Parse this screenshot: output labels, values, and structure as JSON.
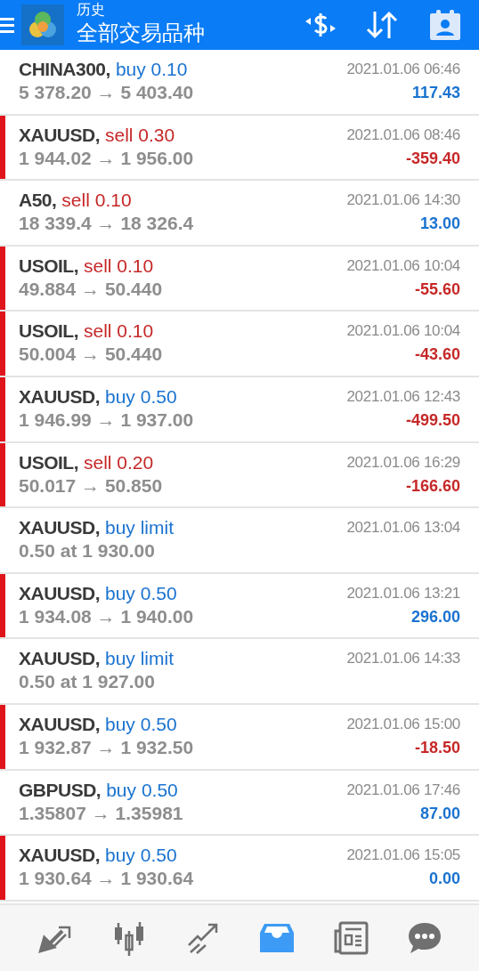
{
  "header": {
    "title": "历史",
    "subtitle": "全部交易品种"
  },
  "rows": [
    {
      "symbol": "CHINA300,",
      "kind": "buy",
      "action": "buy 0.10",
      "prices": "5 378.20 → 5 403.40",
      "time": "2021.01.06 06:46",
      "profit": {
        "text": "117.43",
        "color": "#1a73d0"
      },
      "flagged": false
    },
    {
      "symbol": "XAUUSD,",
      "kind": "sell",
      "action": "sell 0.30",
      "prices": "1 944.02 → 1 956.00",
      "time": "2021.01.06 08:46",
      "profit": {
        "text": "-359.40",
        "color": "#c62828"
      },
      "flagged": true
    },
    {
      "symbol": "A50,",
      "kind": "sell",
      "action": "sell 0.10",
      "prices": "18 339.4 → 18 326.4",
      "time": "2021.01.06 14:30",
      "profit": {
        "text": "13.00",
        "color": "#1a73d0"
      },
      "flagged": false
    },
    {
      "symbol": "USOIL,",
      "kind": "sell",
      "action": "sell 0.10",
      "prices": "49.884 → 50.440",
      "time": "2021.01.06 10:04",
      "profit": {
        "text": "-55.60",
        "color": "#c62828"
      },
      "flagged": true
    },
    {
      "symbol": "USOIL,",
      "kind": "sell",
      "action": "sell 0.10",
      "prices": "50.004 → 50.440",
      "time": "2021.01.06 10:04",
      "profit": {
        "text": "-43.60",
        "color": "#c62828"
      },
      "flagged": true
    },
    {
      "symbol": "XAUUSD,",
      "kind": "buy",
      "action": "buy 0.50",
      "prices": "1 946.99 → 1 937.00",
      "time": "2021.01.06 12:43",
      "profit": {
        "text": "-499.50",
        "color": "#c62828"
      },
      "flagged": true
    },
    {
      "symbol": "USOIL,",
      "kind": "sell",
      "action": "sell 0.20",
      "prices": "50.017 → 50.850",
      "time": "2021.01.06 16:29",
      "profit": {
        "text": "-166.60",
        "color": "#c62828"
      },
      "flagged": true
    },
    {
      "symbol": "XAUUSD,",
      "kind": "buy",
      "action": "buy limit",
      "prices": "0.50 at 1 930.00",
      "time": "2021.01.06 13:04",
      "flagged": false
    },
    {
      "symbol": "XAUUSD,",
      "kind": "buy",
      "action": "buy 0.50",
      "prices": "1 934.08 → 1 940.00",
      "time": "2021.01.06 13:21",
      "profit": {
        "text": "296.00",
        "color": "#1a73d0"
      },
      "flagged": true
    },
    {
      "symbol": "XAUUSD,",
      "kind": "buy",
      "action": "buy limit",
      "prices": "0.50 at 1 927.00",
      "time": "2021.01.06 14:33",
      "flagged": false
    },
    {
      "symbol": "XAUUSD,",
      "kind": "buy",
      "action": "buy 0.50",
      "prices": "1 932.87 → 1 932.50",
      "time": "2021.01.06 15:00",
      "profit": {
        "text": "-18.50",
        "color": "#c62828"
      },
      "flagged": true
    },
    {
      "symbol": "GBPUSD,",
      "kind": "buy",
      "action": "buy 0.50",
      "prices": "1.35807 → 1.35981",
      "time": "2021.01.06 17:46",
      "profit": {
        "text": "87.00",
        "color": "#1a73d0"
      },
      "flagged": false
    },
    {
      "symbol": "XAUUSD,",
      "kind": "buy",
      "action": "buy 0.50",
      "prices": "1 930.64 → 1 930.64",
      "time": "2021.01.06 15:05",
      "profit": {
        "text": "0.00",
        "color": "#1a73d0"
      },
      "flagged": true
    }
  ],
  "nav": [
    {
      "kind": "trade",
      "selected": false
    },
    {
      "kind": "chart",
      "selected": false
    },
    {
      "kind": "trend",
      "selected": false
    },
    {
      "kind": "inbox",
      "selected": true
    },
    {
      "kind": "news",
      "selected": false
    },
    {
      "kind": "chat",
      "selected": false
    }
  ]
}
